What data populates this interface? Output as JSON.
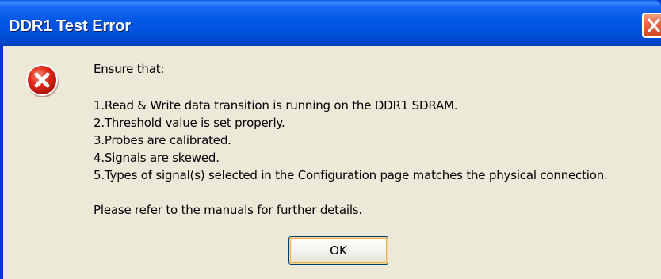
{
  "window": {
    "title": "DDR1 Test Error",
    "close_icon": "close-icon"
  },
  "dialog": {
    "icon": "error-icon",
    "heading": "Ensure that:",
    "items": [
      "1.Read & Write data transition is running on the DDR1 SDRAM.",
      "2.Threshold value is set properly.",
      "3.Probes are calibrated.",
      "4.Signals are skewed.",
      "5.Types of signal(s) selected in the Configuration page matches the physical connection."
    ],
    "footer": "Please refer to the manuals for further details.",
    "ok_label": "OK"
  },
  "colors": {
    "titlebar": "#0058e6",
    "dialog_bg": "#ece9d8",
    "error_red": "#d8241c",
    "close_red": "#e56a45"
  }
}
